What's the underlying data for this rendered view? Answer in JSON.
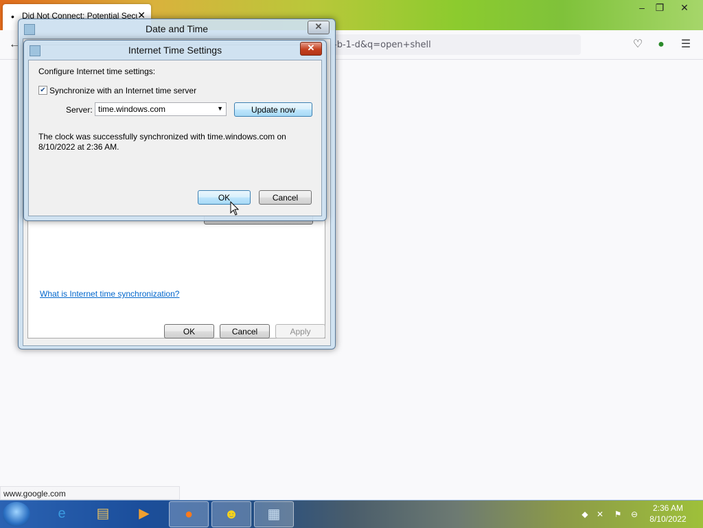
{
  "browser": {
    "tab_title": "Did Not Connect: Potential Security Issue",
    "tab_close": "✕",
    "url_fragment": "-b-1-d&q=open+shell",
    "status_url": "www.google.com",
    "win_minimize": "–",
    "win_restore": "❐",
    "win_close": "✕"
  },
  "date_time_dialog": {
    "title": "Date and Time",
    "close_label": "✕",
    "help_link": "What is Internet time synchronization?",
    "ok_label": "OK",
    "cancel_label": "Cancel",
    "apply_label": "Apply"
  },
  "internet_time_dialog": {
    "title": "Internet Time Settings",
    "close_label": "✕",
    "heading": "Configure Internet time settings:",
    "sync_label": "Synchronize with an Internet time server",
    "sync_checked": true,
    "server_label": "Server:",
    "server_value": "time.windows.com",
    "update_label": "Update now",
    "message_line1": "The clock was successfully synchronized with time.windows.com on",
    "message_line2": "8/10/2022 at 2:36 AM.",
    "ok_label": "OK",
    "cancel_label": "Cancel"
  },
  "taskbar": {
    "time": "2:36 AM",
    "date": "8/10/2022",
    "pinned": [
      "internet-explorer",
      "file-explorer",
      "media-player",
      "firefox",
      "yahoo-messenger",
      "date-time-control-panel"
    ]
  }
}
